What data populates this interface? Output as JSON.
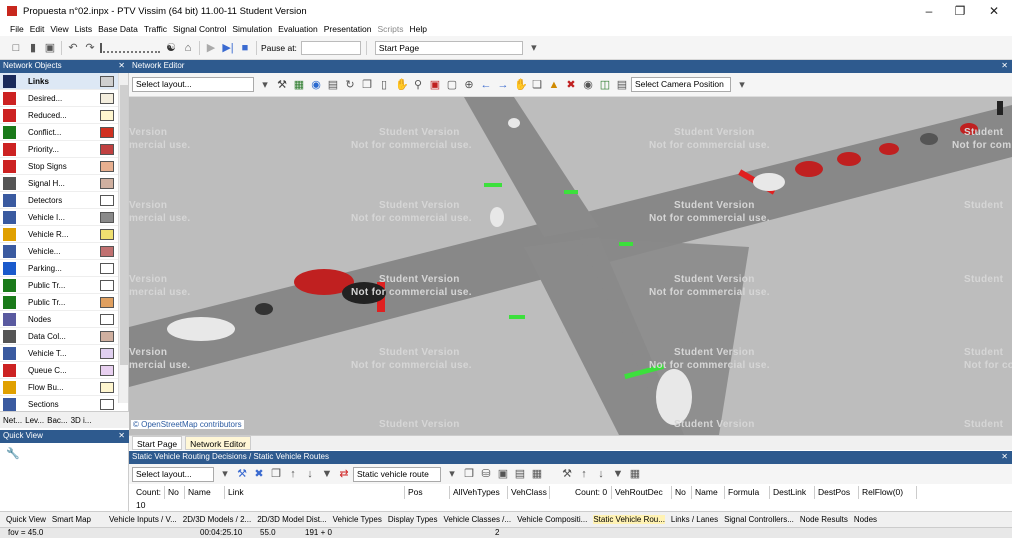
{
  "window": {
    "title": "Propuesta n°02.inpx - PTV Vissim (64 bit) 11.00-11 Student Version",
    "minimize_glyph": "–",
    "maximize_glyph": "❐",
    "close_glyph": "✕"
  },
  "menu": [
    "File",
    "Edit",
    "View",
    "Lists",
    "Base Data",
    "Traffic",
    "Signal Control",
    "Simulation",
    "Evaluation",
    "Presentation",
    "Scripts",
    "Help"
  ],
  "toolbar": {
    "pause_label": "Pause at:",
    "start_page": "Start Page"
  },
  "network_objects": {
    "title": "Network Objects",
    "close": "✕",
    "items": [
      {
        "label": "Links",
        "icon": "links-icon",
        "color": "#1a2a5a",
        "swatch": "#cfcfcf"
      },
      {
        "label": "Desired...",
        "icon": "desired-speed-icon",
        "color": "#cc2222",
        "swatch": "#f4eede"
      },
      {
        "label": "Reduced...",
        "icon": "reduced-speed-icon",
        "color": "#cc2222",
        "swatch": "#fff6cf"
      },
      {
        "label": "Conflict...",
        "icon": "conflict-area-icon",
        "color": "#1a7a1a",
        "swatch": "#d03020"
      },
      {
        "label": "Priority...",
        "icon": "priority-rule-icon",
        "color": "#cc2222",
        "swatch": "#c04040"
      },
      {
        "label": "Stop Signs",
        "icon": "stop-sign-icon",
        "color": "#cc2222",
        "swatch": "#e8b090"
      },
      {
        "label": "Signal H...",
        "icon": "signal-head-icon",
        "color": "#555555",
        "swatch": "#d0b0a0"
      },
      {
        "label": "Detectors",
        "icon": "detector-icon",
        "color": "#3a5aa0",
        "swatch": "#ffffff"
      },
      {
        "label": "Vehicle I...",
        "icon": "vehicle-input-icon",
        "color": "#3a5aa0",
        "swatch": "#8a8a8a"
      },
      {
        "label": "Vehicle R...",
        "icon": "vehicle-route-icon",
        "color": "#e0a000",
        "swatch": "#f0e070"
      },
      {
        "label": "Vehicle...",
        "icon": "vehicle-attributes-icon",
        "color": "#3a5aa0",
        "swatch": "#c07070"
      },
      {
        "label": "Parking...",
        "icon": "parking-icon",
        "color": "#1a5acc",
        "swatch": "#ffffff"
      },
      {
        "label": "Public Tr...",
        "icon": "public-transport-stop-icon",
        "color": "#1a7a1a",
        "swatch": "#ffffff"
      },
      {
        "label": "Public Tr...",
        "icon": "public-transport-line-icon",
        "color": "#1a7a1a",
        "swatch": "#e0a060"
      },
      {
        "label": "Nodes",
        "icon": "nodes-icon",
        "color": "#5a5aa0",
        "swatch": "#ffffff"
      },
      {
        "label": "Data Col...",
        "icon": "data-collection-icon",
        "color": "#555555",
        "swatch": "#d0b0a0"
      },
      {
        "label": "Vehicle T...",
        "icon": "vehicle-travel-time-icon",
        "color": "#3a5aa0",
        "swatch": "#e0d0f0"
      },
      {
        "label": "Queue C...",
        "icon": "queue-counter-icon",
        "color": "#cc2222",
        "swatch": "#e8d0f0"
      },
      {
        "label": "Flow Bu...",
        "icon": "flow-bundle-icon",
        "color": "#e0a000",
        "swatch": "#fff6cf"
      },
      {
        "label": "Sections",
        "icon": "sections-icon",
        "color": "#3a5aa0",
        "swatch": "#ffffff"
      }
    ],
    "tabs": [
      "Net...",
      "Lev...",
      "Bac...",
      "3D i..."
    ]
  },
  "quick_view": {
    "title": "Quick View",
    "close": "✕"
  },
  "editor": {
    "title": "Network Editor",
    "layout_select": "Select layout...",
    "camera_select": "Select Camera Position",
    "osm_credit": "© OpenStreetMap contributors",
    "watermark_a": "Student Version",
    "watermark_b": "Not for commercial use.",
    "watermark_frag_a": "Version",
    "watermark_frag_b": "mercial use.",
    "watermark_frag_c": "Student",
    "watermark_frag_d": "Not for com",
    "tabs": [
      "Start Page",
      "Network Editor"
    ]
  },
  "routing": {
    "title": "Static Vehicle Routing Decisions / Static Vehicle Routes",
    "layout_select": "Select layout...",
    "routes_select": "Static vehicle route",
    "left_headers": [
      "Count: 10",
      "No",
      "Name",
      "Link",
      "Pos",
      "AllVehTypes",
      "VehClass"
    ],
    "right_headers": [
      "Count: 0",
      "VehRoutDec",
      "No",
      "Name",
      "Formula",
      "DestLink",
      "DestPos",
      "RelFlow(0)"
    ]
  },
  "bottom_tabs": {
    "left": [
      "Quick View",
      "Smart Map"
    ],
    "right": [
      "Vehicle Inputs / V...",
      "2D/3D Models / 2...",
      "2D/3D Model Dist...",
      "Vehicle Types",
      "Display Types",
      "Vehicle Classes /...",
      "Vehicle Compositi...",
      "Static Vehicle Rou...",
      "Links / Lanes",
      "Signal Controllers...",
      "Node Results",
      "Nodes"
    ]
  },
  "status": {
    "fov": "fov = 45.0",
    "time": "00:04:25.10",
    "speed": "55.0",
    "coords": "191 + 0",
    "count": "2"
  }
}
